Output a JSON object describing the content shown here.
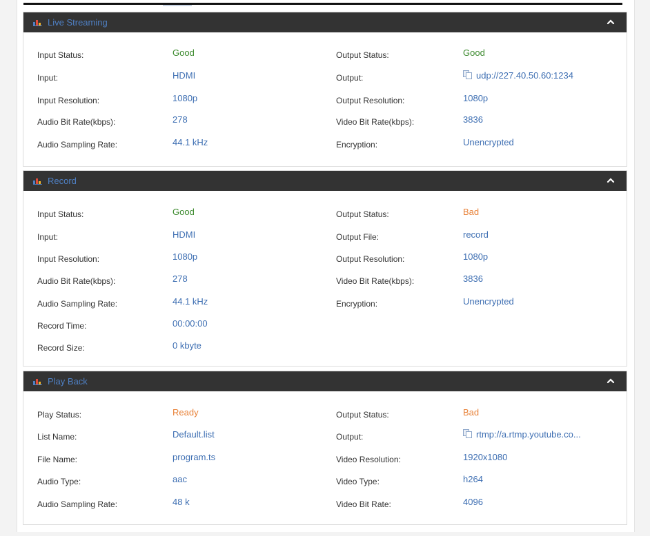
{
  "colors": {
    "header_bg": "#333333",
    "header_title": "#4f80c4",
    "value_blue": "#3d6eb2",
    "status_good": "#3c8a2e",
    "status_warn": "#e8833a"
  },
  "panels": {
    "live": {
      "title": "Live Streaming",
      "left": [
        {
          "label": "Input Status:",
          "value": "Good"
        },
        {
          "label": "Input:",
          "value": "HDMI"
        },
        {
          "label": "Input Resolution:",
          "value": "1080p"
        },
        {
          "label": "Audio Bit Rate(kbps):",
          "value": "278"
        },
        {
          "label": "Audio Sampling Rate:",
          "value": "44.1 kHz"
        }
      ],
      "right": [
        {
          "label": "Output Status:",
          "value": "Good"
        },
        {
          "label": "Output:",
          "value": "udp://227.40.50.60:1234"
        },
        {
          "label": "Output Resolution:",
          "value": "1080p"
        },
        {
          "label": "Video Bit Rate(kbps):",
          "value": "3836"
        },
        {
          "label": "Encryption:",
          "value": "Unencrypted"
        }
      ]
    },
    "record": {
      "title": "Record",
      "left": [
        {
          "label": "Input Status:",
          "value": "Good"
        },
        {
          "label": "Input:",
          "value": "HDMI"
        },
        {
          "label": "Input Resolution:",
          "value": "1080p"
        },
        {
          "label": "Audio Bit Rate(kbps):",
          "value": "278"
        },
        {
          "label": "Audio Sampling Rate:",
          "value": "44.1 kHz"
        },
        {
          "label": "Record Time:",
          "value": "00:00:00"
        },
        {
          "label": "Record Size:",
          "value": "0 kbyte"
        }
      ],
      "right": [
        {
          "label": "Output Status:",
          "value": "Bad"
        },
        {
          "label": "Output File:",
          "value": "record"
        },
        {
          "label": "Output Resolution:",
          "value": "1080p"
        },
        {
          "label": "Video Bit Rate(kbps):",
          "value": "3836"
        },
        {
          "label": "Encryption:",
          "value": "Unencrypted"
        }
      ]
    },
    "playback": {
      "title": "Play Back",
      "left": [
        {
          "label": "Play Status:",
          "value": "Ready"
        },
        {
          "label": "List Name:",
          "value": "Default.list"
        },
        {
          "label": "File Name:",
          "value": "program.ts"
        },
        {
          "label": "Audio Type:",
          "value": "aac"
        },
        {
          "label": "Audio Sampling Rate:",
          "value": "48 k"
        }
      ],
      "right": [
        {
          "label": "Output Status:",
          "value": "Bad"
        },
        {
          "label": "Output:",
          "value": "rtmp://a.rtmp.youtube.co..."
        },
        {
          "label": "Video Resolution:",
          "value": "1920x1080"
        },
        {
          "label": "Video Type:",
          "value": "h264"
        },
        {
          "label": "Video Bit Rate:",
          "value": "4096"
        }
      ]
    }
  }
}
